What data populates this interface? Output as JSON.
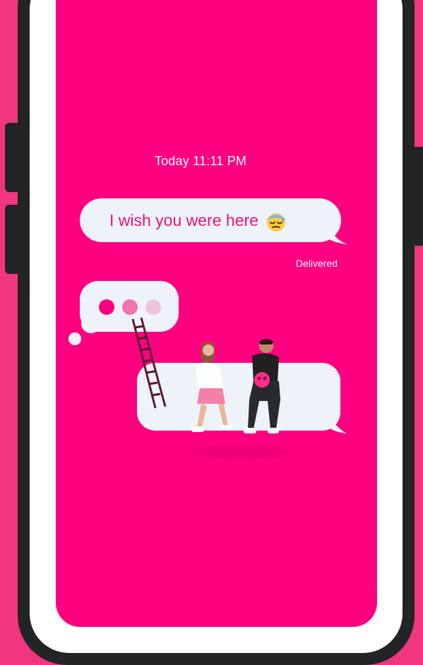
{
  "thread": {
    "timestamp": "Today 11:11 PM",
    "message_text": "I wish you were here",
    "message_emoji": "downcast-face-with-sweat-emoji",
    "status": "Delivered"
  },
  "typing_indicator": {
    "dots": 3
  },
  "colors": {
    "background": "#F0377D",
    "screen": "#FF0080",
    "bubble": "#EEF3FA",
    "message_text": "#E8117A",
    "phone_frame": "#222426"
  }
}
